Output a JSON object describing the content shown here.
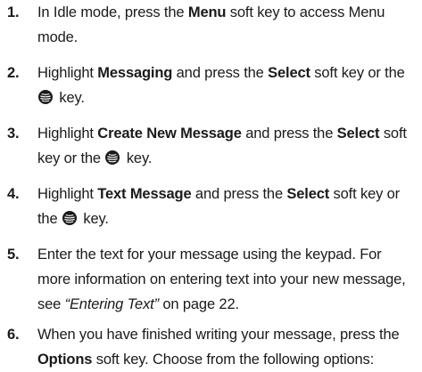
{
  "steps": [
    {
      "number": "1.",
      "lines": [
        [
          "In Idle mode, press the ",
          {
            "b": "Menu"
          },
          " soft key to access Menu"
        ],
        [
          "mode."
        ]
      ]
    },
    {
      "number": "2.",
      "lines": [
        [
          "Highlight ",
          {
            "b": "Messaging"
          },
          " and press the ",
          {
            "b": "Select"
          },
          " soft key or the"
        ],
        [
          {
            "icon": "ok-key-icon"
          },
          " key."
        ]
      ]
    },
    {
      "number": "3.",
      "lines": [
        [
          "Highlight ",
          {
            "b": "Create New Message"
          },
          " and press the ",
          {
            "b": "Select"
          },
          " soft"
        ],
        [
          "key or the ",
          {
            "icon": "ok-key-icon"
          },
          " key."
        ]
      ]
    },
    {
      "number": "4.",
      "lines": [
        [
          "Highlight ",
          {
            "b": "Text Message"
          },
          " and press the ",
          {
            "b": "Select"
          },
          " soft key or"
        ],
        [
          "the ",
          {
            "icon": "ok-key-icon"
          },
          " key."
        ]
      ]
    },
    {
      "number": "5.",
      "lines": [
        [
          "Enter the text for your message using the keypad. For"
        ],
        [
          "more information on entering text into your new message,"
        ],
        [
          "see ",
          {
            "i": "“Entering Text”"
          },
          " on page 22."
        ]
      ]
    },
    {
      "number": "6.",
      "lines": [
        [
          "When you have finished writing your message, press the"
        ],
        [
          {
            "b": "Options"
          },
          " soft key. Choose from the following options:"
        ]
      ]
    }
  ],
  "colors": {
    "text": "#1a1a1a",
    "background": "#ffffff"
  }
}
